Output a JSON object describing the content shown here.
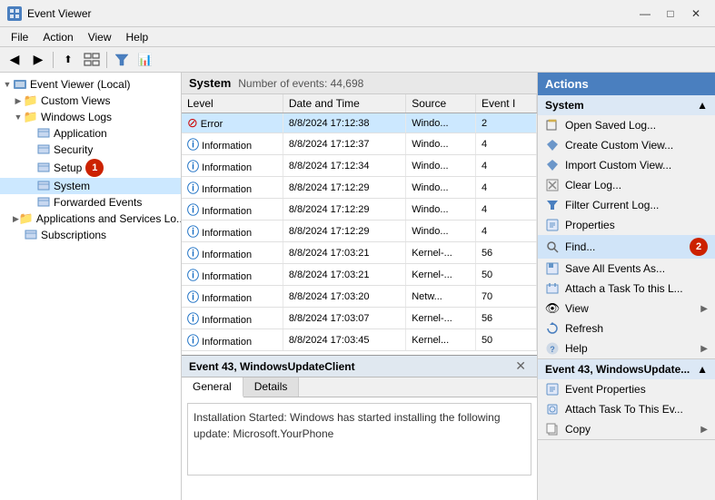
{
  "titleBar": {
    "title": "Event Viewer",
    "minimize": "—",
    "maximize": "□",
    "close": "✕"
  },
  "menuBar": {
    "items": [
      "File",
      "Action",
      "View",
      "Help"
    ]
  },
  "toolbar": {
    "buttons": [
      "◀",
      "▶",
      "⬆",
      "🖥",
      "📋",
      "🔑",
      "📊"
    ]
  },
  "tree": {
    "items": [
      {
        "id": "local",
        "label": "Event Viewer (Local)",
        "level": 0,
        "expanded": true,
        "type": "root"
      },
      {
        "id": "customviews",
        "label": "Custom Views",
        "level": 1,
        "expanded": false,
        "type": "folder"
      },
      {
        "id": "windowslogs",
        "label": "Windows Logs",
        "level": 1,
        "expanded": true,
        "type": "folder"
      },
      {
        "id": "application",
        "label": "Application",
        "level": 2,
        "expanded": false,
        "type": "log"
      },
      {
        "id": "security",
        "label": "Security",
        "level": 2,
        "expanded": false,
        "type": "log"
      },
      {
        "id": "setup",
        "label": "Setup",
        "level": 2,
        "expanded": false,
        "type": "log",
        "badge": "1"
      },
      {
        "id": "system",
        "label": "System",
        "level": 2,
        "expanded": false,
        "type": "log",
        "selected": true
      },
      {
        "id": "forwardedevents",
        "label": "Forwarded Events",
        "level": 2,
        "expanded": false,
        "type": "log"
      },
      {
        "id": "appservices",
        "label": "Applications and Services Lo...",
        "level": 1,
        "expanded": false,
        "type": "folder"
      },
      {
        "id": "subscriptions",
        "label": "Subscriptions",
        "level": 1,
        "expanded": false,
        "type": "log"
      }
    ]
  },
  "logHeader": {
    "title": "System",
    "countLabel": "Number of events: 44,698"
  },
  "tableHeaders": [
    "Level",
    "Date and Time",
    "Source",
    "Event I"
  ],
  "events": [
    {
      "level": "Error",
      "levelIcon": "error",
      "datetime": "8/8/2024 17:12:38",
      "source": "Windo...",
      "eventId": "2"
    },
    {
      "level": "Information",
      "levelIcon": "info",
      "datetime": "8/8/2024 17:12:37",
      "source": "Windo...",
      "eventId": "4"
    },
    {
      "level": "Information",
      "levelIcon": "info",
      "datetime": "8/8/2024 17:12:34",
      "source": "Windo...",
      "eventId": "4"
    },
    {
      "level": "Information",
      "levelIcon": "info",
      "datetime": "8/8/2024 17:12:29",
      "source": "Windo...",
      "eventId": "4"
    },
    {
      "level": "Information",
      "levelIcon": "info",
      "datetime": "8/8/2024 17:12:29",
      "source": "Windo...",
      "eventId": "4"
    },
    {
      "level": "Information",
      "levelIcon": "info",
      "datetime": "8/8/2024 17:12:29",
      "source": "Windo...",
      "eventId": "4"
    },
    {
      "level": "Information",
      "levelIcon": "info",
      "datetime": "8/8/2024 17:03:21",
      "source": "Kernel-...",
      "eventId": "56"
    },
    {
      "level": "Information",
      "levelIcon": "info",
      "datetime": "8/8/2024 17:03:21",
      "source": "Kernel-...",
      "eventId": "50"
    },
    {
      "level": "Information",
      "levelIcon": "info",
      "datetime": "8/8/2024 17:03:20",
      "source": "Netw...",
      "eventId": "70"
    },
    {
      "level": "Information",
      "levelIcon": "info",
      "datetime": "8/8/2024 17:03:07",
      "source": "Kernel-...",
      "eventId": "56"
    },
    {
      "level": "Information",
      "levelIcon": "info",
      "datetime": "8/8/2024 17:03:45",
      "source": "Kernel...",
      "eventId": "50"
    }
  ],
  "detailPanel": {
    "title": "Event 43, WindowsUpdateClient",
    "closeBtn": "✕",
    "tabs": [
      "General",
      "Details"
    ],
    "activeTab": "General",
    "content": "Installation Started: Windows has started installing the following update:\nMicrosoft.YourPhone"
  },
  "actionsPanel": {
    "header": "Actions",
    "sections": [
      {
        "title": "System",
        "titleArrow": "▲",
        "items": [
          {
            "icon": "📂",
            "label": "Open Saved Log...",
            "arrow": ""
          },
          {
            "icon": "🔍",
            "label": "Create Custom View...",
            "arrow": ""
          },
          {
            "icon": "📥",
            "label": "Import Custom View...",
            "arrow": ""
          },
          {
            "icon": "🗑",
            "label": "Clear Log...",
            "arrow": ""
          },
          {
            "icon": "🔽",
            "label": "Filter Current Log...",
            "arrow": ""
          },
          {
            "icon": "📋",
            "label": "Properties",
            "arrow": ""
          },
          {
            "icon": "🔎",
            "label": "Find...",
            "arrow": "",
            "badge": "2",
            "highlight": true
          },
          {
            "icon": "💾",
            "label": "Save All Events As...",
            "arrow": ""
          },
          {
            "icon": "📌",
            "label": "Attach a Task To this L...",
            "arrow": ""
          },
          {
            "icon": "👁",
            "label": "View",
            "arrow": "▶"
          },
          {
            "icon": "🔄",
            "label": "Refresh",
            "arrow": ""
          },
          {
            "icon": "❓",
            "label": "Help",
            "arrow": "▶"
          }
        ]
      },
      {
        "title": "Event 43, WindowsUpdate...",
        "titleArrow": "▲",
        "items": [
          {
            "icon": "📋",
            "label": "Event Properties",
            "arrow": ""
          },
          {
            "icon": "📌",
            "label": "Attach Task To This Ev...",
            "arrow": ""
          },
          {
            "icon": "📄",
            "label": "Copy",
            "arrow": "▶"
          }
        ]
      }
    ]
  }
}
